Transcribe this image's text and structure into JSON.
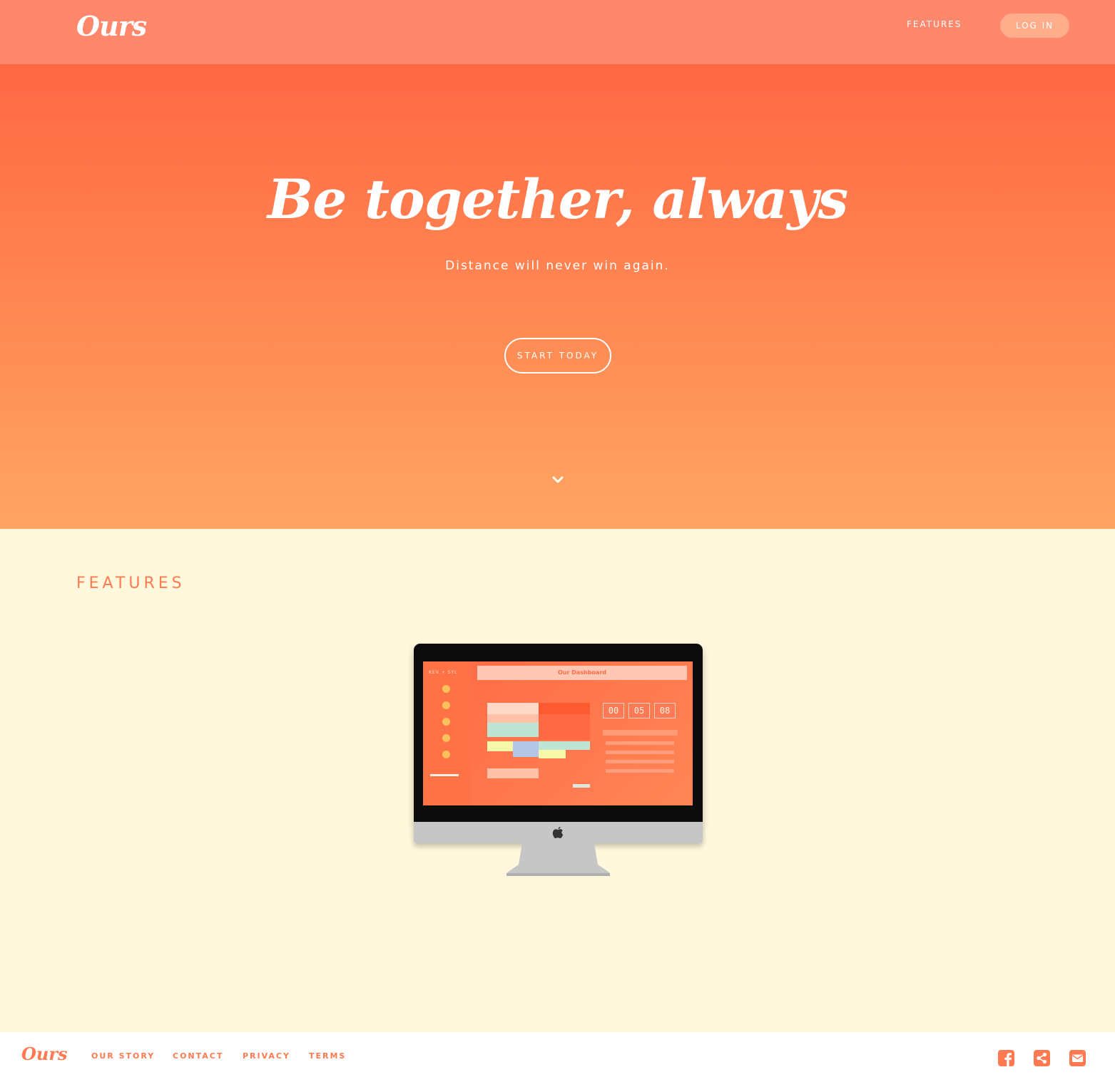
{
  "navbar": {
    "logo": "Ours",
    "features_link": "FEATURES",
    "login_button": "LOG IN"
  },
  "hero": {
    "title": "Be together, always",
    "subtitle": "Distance will never win again.",
    "cta": "START TODAY",
    "scroll_icon": "chevron-down-icon"
  },
  "features": {
    "heading": "FEATURES",
    "device": "monitor",
    "screen_title": "Our Dashboard",
    "screen_sidebar_title": "KEV + SYL",
    "countdown": [
      "00",
      "05",
      "08"
    ]
  },
  "footer": {
    "logo": "Ours",
    "links": [
      "OUR STORY",
      "CONTACT",
      "PRIVACY",
      "TERMS"
    ],
    "icons": [
      "facebook-icon",
      "share-icon",
      "mail-icon"
    ]
  },
  "colors": {
    "navbar": "#ff876c",
    "hero_top": "#ff6843",
    "hero_bottom": "#ffa562",
    "features_bg": "#fff8dc",
    "accent": "#ff7a50"
  }
}
